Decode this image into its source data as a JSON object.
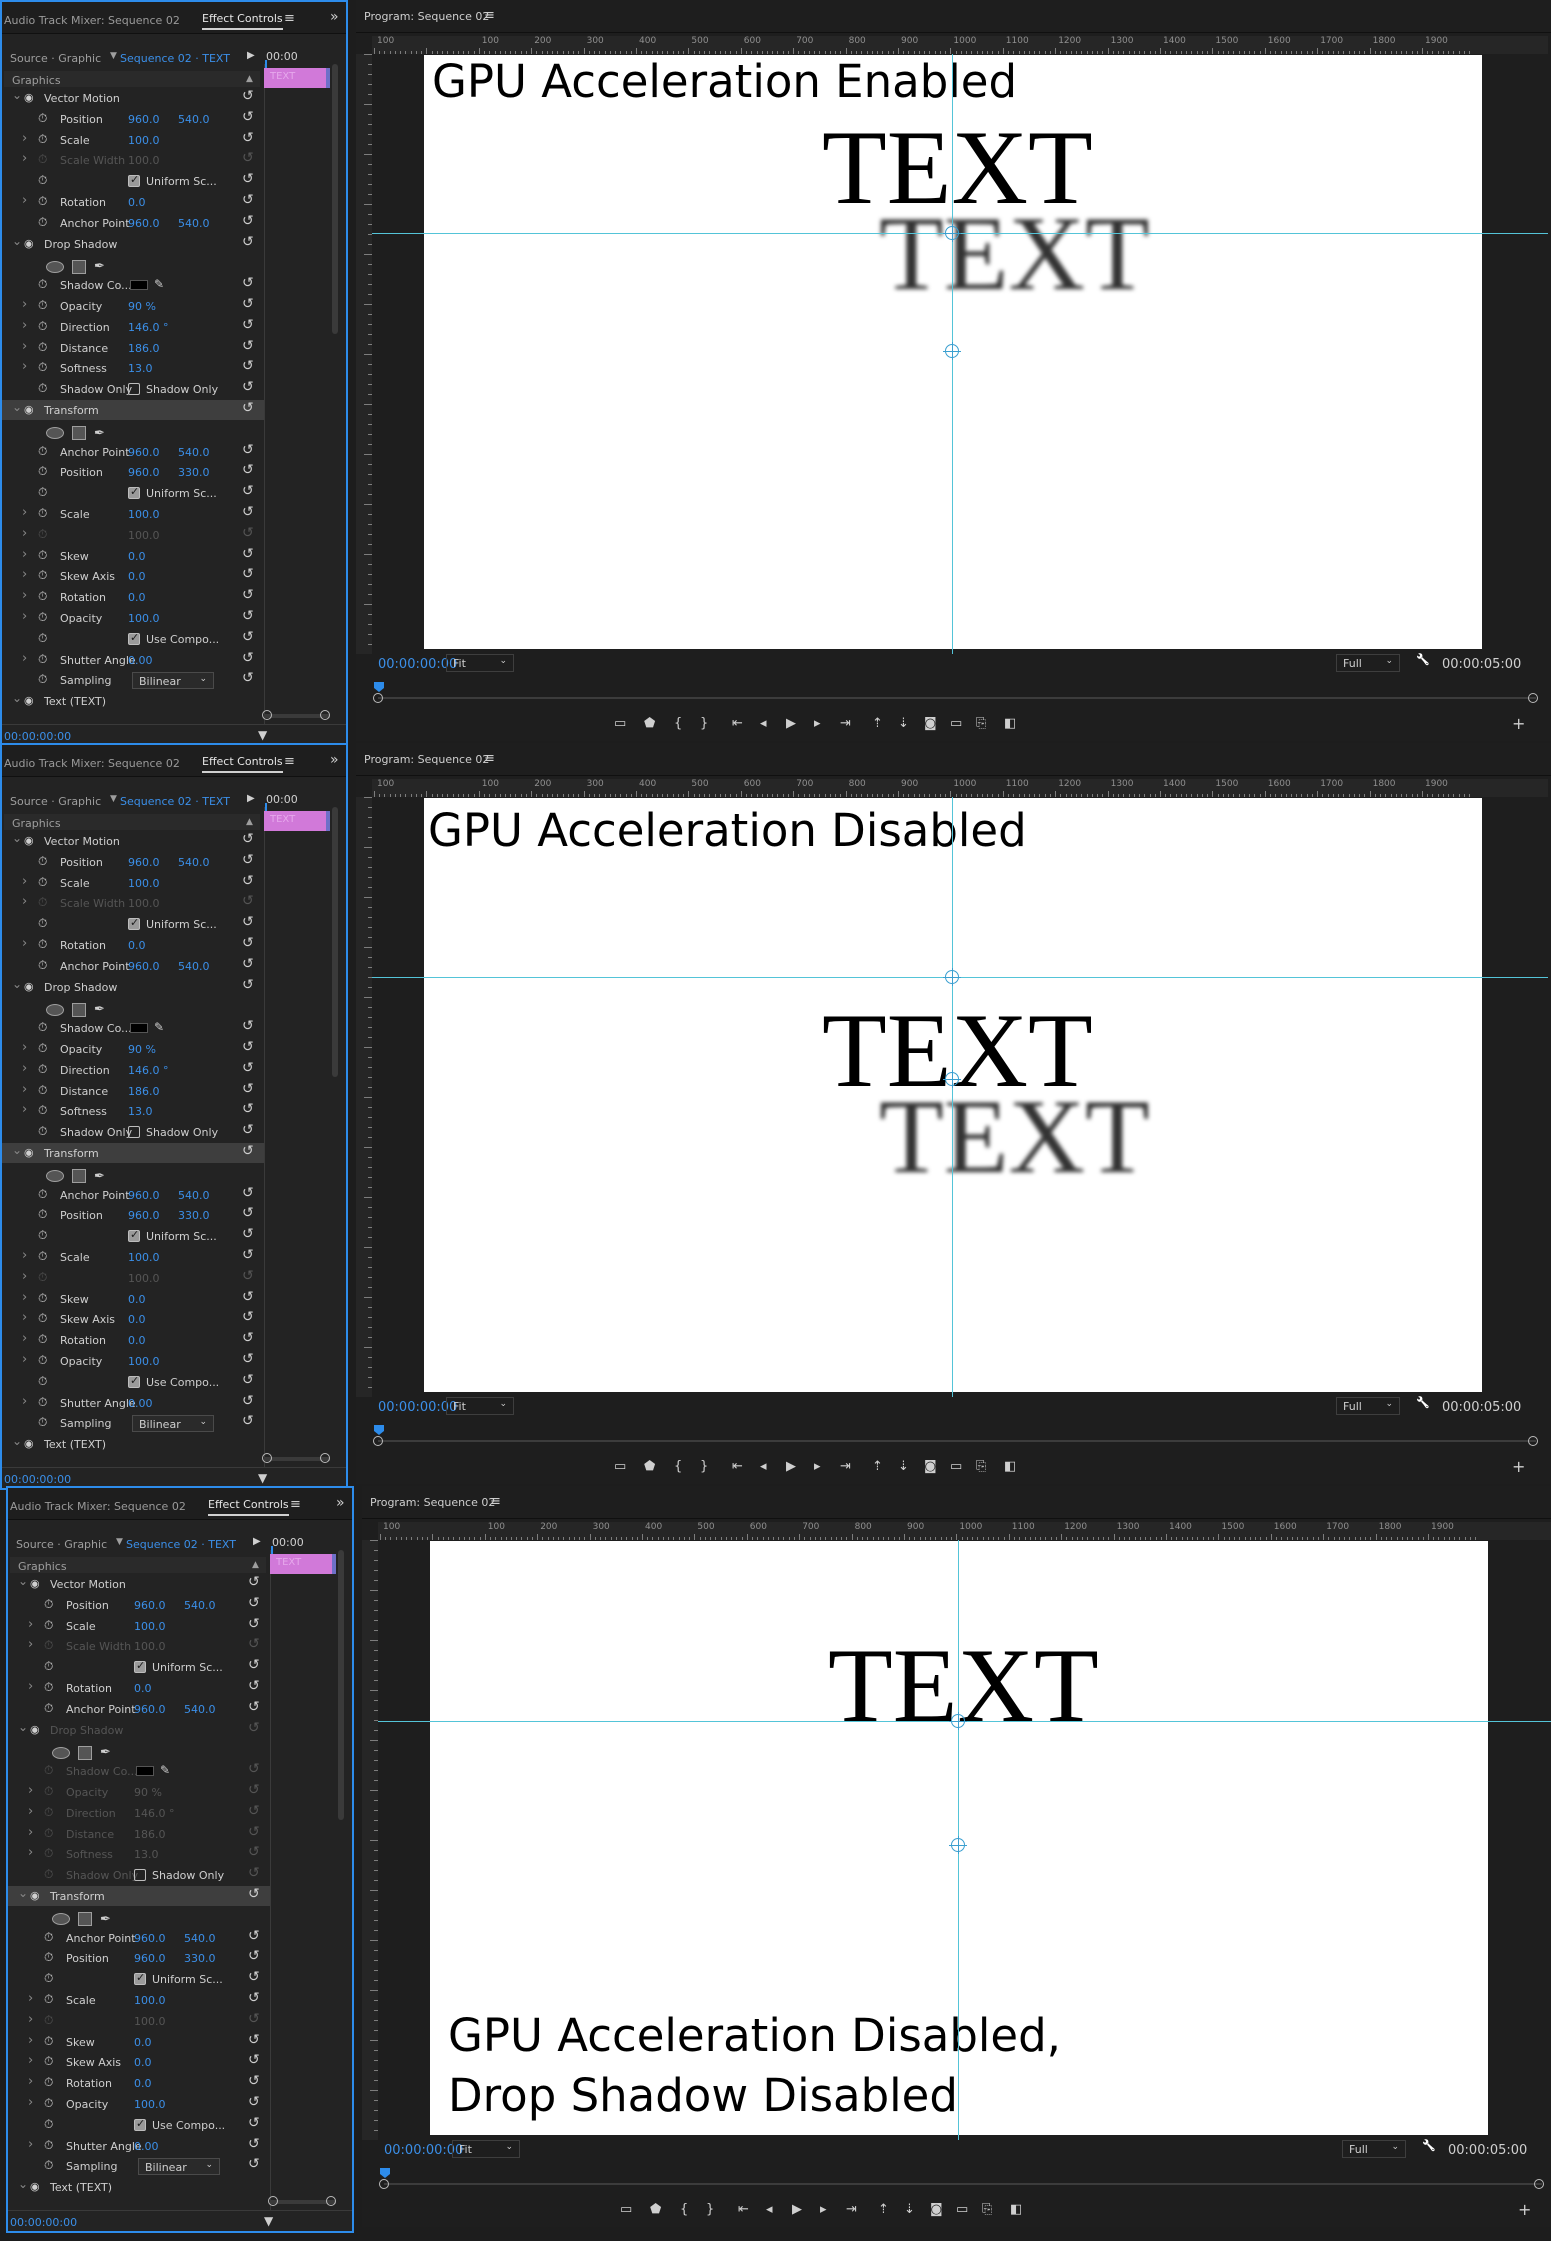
{
  "sections": [
    {
      "left_panel": {
        "tab_audio": "Audio Track Mixer: Sequence 02",
        "tab_effects": "Effect Controls",
        "source": "Source · Graphic",
        "sequence": "Sequence 02 · TEXT",
        "timecode_top": "00:00",
        "graphics": "Graphics",
        "clip_label": "TEXT",
        "timecode": "00:00:00:00"
      },
      "monitor": {
        "title": "Program: Sequence 02",
        "caption": "GPU Acceleration Enabled",
        "text": "TEXT",
        "shadow_text": "TEXT",
        "timecode": "00:00:00:00",
        "fit": "Fit",
        "quality": "Full",
        "duration": "00:00:05:00"
      }
    },
    {
      "left_panel": {
        "tab_audio": "Audio Track Mixer: Sequence 02",
        "tab_effects": "Effect Controls",
        "source": "Source · Graphic",
        "sequence": "Sequence 02 · TEXT",
        "timecode_top": "00:00",
        "graphics": "Graphics",
        "clip_label": "TEXT",
        "timecode": "00:00:00:00"
      },
      "monitor": {
        "title": "Program: Sequence 02",
        "caption": "GPU Acceleration Disabled",
        "text": "TEXT",
        "shadow_text": "TEXT",
        "timecode": "00:00:00:00",
        "fit": "Fit",
        "quality": "Full",
        "duration": "00:00:05:00"
      }
    },
    {
      "left_panel": {
        "tab_audio": "Audio Track Mixer: Sequence 02",
        "tab_effects": "Effect Controls",
        "source": "Source · Graphic",
        "sequence": "Sequence 02 · TEXT",
        "timecode_top": "00:00",
        "graphics": "Graphics",
        "clip_label": "TEXT",
        "timecode": "00:00:00:00"
      },
      "monitor": {
        "title": "Program: Sequence 02",
        "caption_line1": "GPU Acceleration Disabled,",
        "caption_line2": "Drop Shadow Disabled",
        "text": "TEXT",
        "timecode": "00:00:00:00",
        "fit": "Fit",
        "quality": "Full",
        "duration": "00:00:05:00"
      }
    }
  ],
  "effect_rows": [
    {
      "label": "Vector Motion",
      "type": "group"
    },
    {
      "label": "Position",
      "v1": "960.0",
      "v2": "540.0"
    },
    {
      "label": "Scale",
      "v1": "100.0",
      "expand": true
    },
    {
      "label": "Scale Width",
      "v1": "100.0",
      "expand": true,
      "dim": true
    },
    {
      "label": "Uniform Sc...",
      "type": "checkbox"
    },
    {
      "label": "Rotation",
      "v1": "0.0",
      "expand": true
    },
    {
      "label": "Anchor Point",
      "v1": "960.0",
      "v2": "540.0"
    },
    {
      "label": "Drop Shadow",
      "type": "group"
    },
    {
      "type": "shapes"
    },
    {
      "label": "Shadow Co...",
      "type": "color"
    },
    {
      "label": "Opacity",
      "v1": "90 %",
      "expand": true
    },
    {
      "label": "Direction",
      "v1": "146.0 °",
      "expand": true
    },
    {
      "label": "Distance",
      "v1": "186.0",
      "expand": true
    },
    {
      "label": "Softness",
      "v1": "13.0",
      "expand": true
    },
    {
      "label": "Shadow Only",
      "type": "shadowonly",
      "cb_label": "Shadow Only"
    },
    {
      "label": "Transform",
      "type": "group",
      "selected": true
    },
    {
      "type": "shapes"
    },
    {
      "label": "Anchor Point",
      "v1": "960.0",
      "v2": "540.0"
    },
    {
      "label": "Position",
      "v1": "960.0",
      "v2": "330.0"
    },
    {
      "label": "Uniform Sc...",
      "type": "checkbox"
    },
    {
      "label": "Scale",
      "v1": "100.0",
      "expand": true
    },
    {
      "label": "",
      "v1": "100.0",
      "expand": true,
      "dim": true
    },
    {
      "label": "Skew",
      "v1": "0.0",
      "expand": true
    },
    {
      "label": "Skew Axis",
      "v1": "0.0",
      "expand": true
    },
    {
      "label": "Rotation",
      "v1": "0.0",
      "expand": true
    },
    {
      "label": "Opacity",
      "v1": "100.0",
      "expand": true
    },
    {
      "label": "Use Compo...",
      "type": "checkbox"
    },
    {
      "label": "Shutter Angle",
      "v1": "0.00",
      "expand": true
    },
    {
      "label": "Sampling",
      "type": "dropdown",
      "value": "Bilinear"
    },
    {
      "label": "Text (TEXT)",
      "type": "group"
    }
  ],
  "ruler_labels": [
    "100",
    "",
    "100",
    "200",
    "300",
    "400",
    "500",
    "600",
    "700",
    "800",
    "900",
    "1000",
    "1100",
    "1200",
    "1300",
    "1400",
    "1500",
    "1600",
    "1700",
    "1800",
    "1900"
  ]
}
